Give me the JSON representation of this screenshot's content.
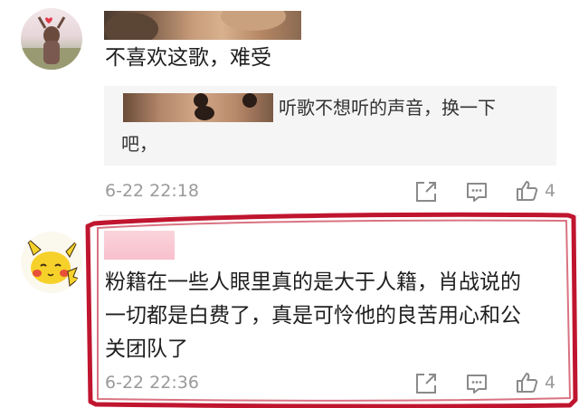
{
  "comment1": {
    "text": "不喜欢这歌，难受",
    "reply_quote": {
      "line1": "听歌不想听的声音，换一下",
      "line2": "吧，"
    },
    "timestamp": "6-22 22:18",
    "like_count": "4"
  },
  "comment2": {
    "lines": [
      "粉籍在一些人眼里真的是大于人籍，肖战说的",
      "一切都是白费了，真是可怜他的良苦用心和公",
      "关团队了"
    ],
    "timestamp": "6-22 22:36",
    "like_count": "4"
  },
  "icons": {
    "share": "share-icon",
    "reply": "comment-icon",
    "like": "thumbs-up-icon"
  },
  "colors": {
    "highlight_border": "#c0152f",
    "meta_text": "#9a9a9a",
    "quote_background": "#f5f5f5"
  }
}
